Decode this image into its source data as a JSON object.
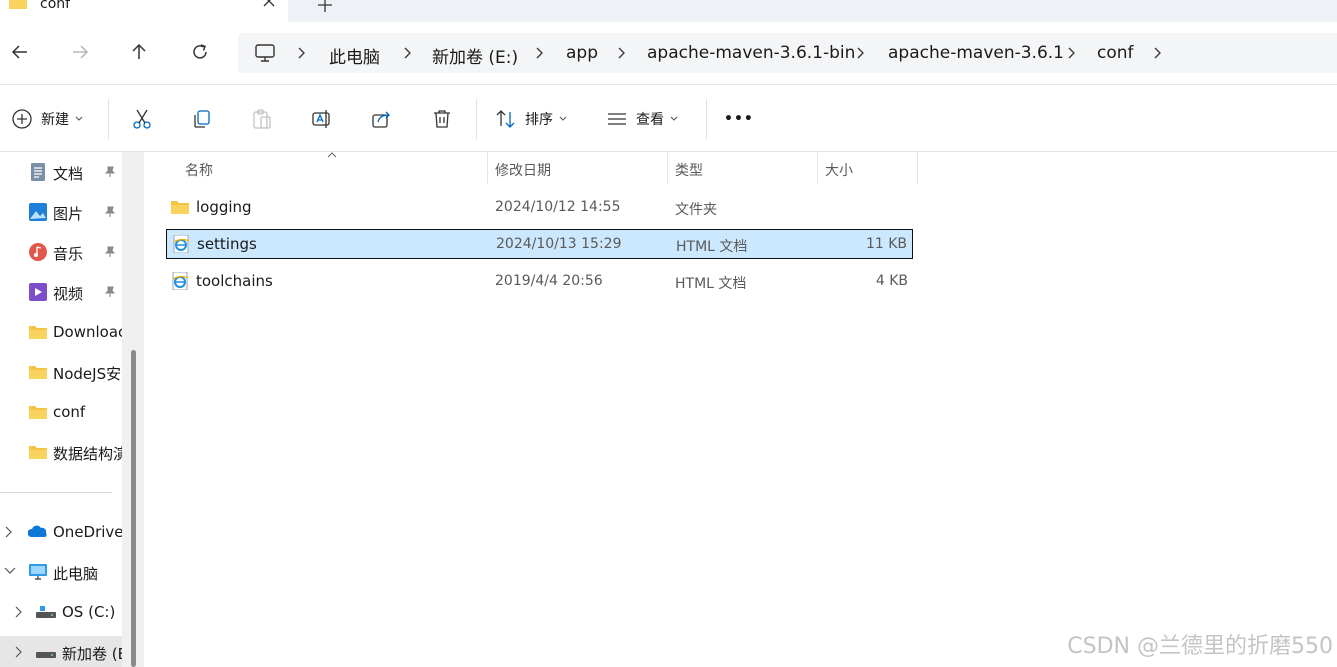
{
  "tab": {
    "title": "conf",
    "new_tab": "+"
  },
  "breadcrumb": [
    "此电脑",
    "新加卷 (E:)",
    "app",
    "apache-maven-3.6.1-bin",
    "apache-maven-3.6.1",
    "conf"
  ],
  "toolbar": {
    "new_label": "新建",
    "sort_label": "排序",
    "view_label": "查看",
    "more_label": "•••"
  },
  "sidebar": {
    "quick_access": [
      {
        "label": "文档",
        "icon": "document-icon"
      },
      {
        "label": "图片",
        "icon": "pictures-icon"
      },
      {
        "label": "音乐",
        "icon": "music-icon"
      },
      {
        "label": "视频",
        "icon": "videos-icon"
      },
      {
        "label": "Downloac",
        "icon": "folder-icon"
      },
      {
        "label": "NodeJS安",
        "icon": "folder-icon"
      },
      {
        "label": "conf",
        "icon": "folder-icon"
      },
      {
        "label": "数据结构演",
        "icon": "folder-icon"
      }
    ],
    "tree": [
      {
        "label": "OneDrive",
        "icon": "onedrive-icon"
      },
      {
        "label": "此电脑",
        "icon": "this-pc-icon"
      },
      {
        "label": "OS (C:)",
        "icon": "drive-icon"
      },
      {
        "label": "新加卷 (E",
        "icon": "drive-icon"
      }
    ]
  },
  "columns": {
    "name": "名称",
    "modified": "修改日期",
    "type": "类型",
    "size": "大小"
  },
  "files": [
    {
      "name": "logging",
      "modified": "2024/10/12 14:55",
      "type": "文件夹",
      "size": "",
      "icon": "folder-icon"
    },
    {
      "name": "settings",
      "modified": "2024/10/13 15:29",
      "type": "HTML 文档",
      "size": "11 KB",
      "icon": "html-file-icon",
      "selected": true
    },
    {
      "name": "toolchains",
      "modified": "2019/4/4 20:56",
      "type": "HTML 文档",
      "size": "4 KB",
      "icon": "html-file-icon"
    }
  ],
  "watermark": "CSDN @兰德里的折磨550",
  "colors": {
    "selection": "#cce8ff",
    "folder": "#f4c542",
    "accent": "#0067c0"
  }
}
